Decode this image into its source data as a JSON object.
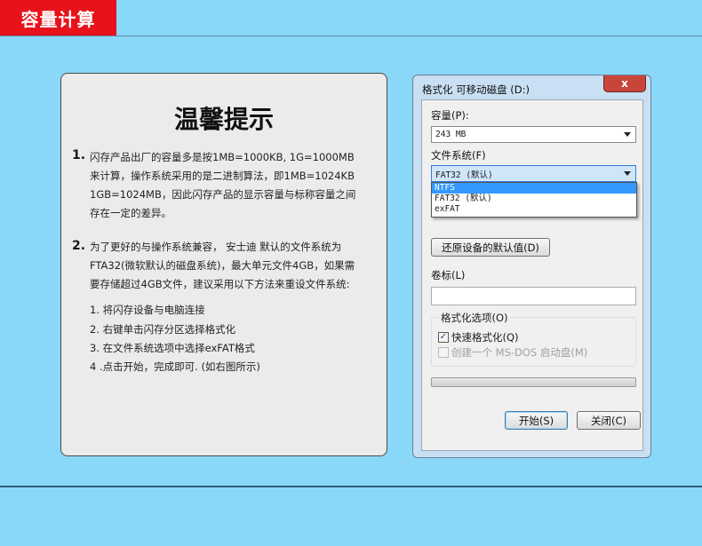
{
  "page": {
    "badge": "容量计算"
  },
  "tips": {
    "title": "温馨提示",
    "item1_num": "1.",
    "item1_lines": [
      "闪存产品出厂的容量多是按1MB=1000KB, 1G=1000MB",
      "来计算，操作系统采用的是二进制算法，即1MB=1024KB",
      "1GB=1024MB，因此闪存产品的显示容量与标称容量之间",
      "存在一定的差异。"
    ],
    "item2_num": "2.",
    "item2_lines": [
      "为了更好的与操作系统兼容，  安士迪 默认的文件系统为",
      "FTA32(微软默认的磁盘系统)，最大单元文件4GB，如果需",
      "要存储超过4GB文件，建议采用以下方法来重设文件系统:"
    ],
    "steps": [
      "1. 将闪存设备与电脑连接",
      "2. 右键单击闪存分区选择格式化",
      "3. 在文件系统选项中选择exFAT格式",
      "4 .点击开始，完成即可. (如右图所示)"
    ]
  },
  "dialog": {
    "title": "格式化 可移动磁盘 (D:)",
    "close_glyph": "x",
    "capacity_label": "容量(P):",
    "capacity_value": "243 MB",
    "fs_label": "文件系统(F)",
    "fs_value": "FAT32 (默认)",
    "fs_options": [
      "NTFS",
      "FAT32 (默认)",
      "exFAT"
    ],
    "fs_highlighted": "NTFS",
    "restore_button": "还原设备的默认值(D)",
    "volume_label": "卷标(L)",
    "volume_value": "",
    "format_options_label": "格式化选项(O)",
    "quick_format_label": "快速格式化(Q)",
    "quick_format_checked": true,
    "boot_disk_label": "创建一个 MS-DOS 启动盘(M)",
    "boot_disk_checked": false,
    "progress": 0,
    "start_button": "开始(S)",
    "close_button": "关闭(C)"
  }
}
